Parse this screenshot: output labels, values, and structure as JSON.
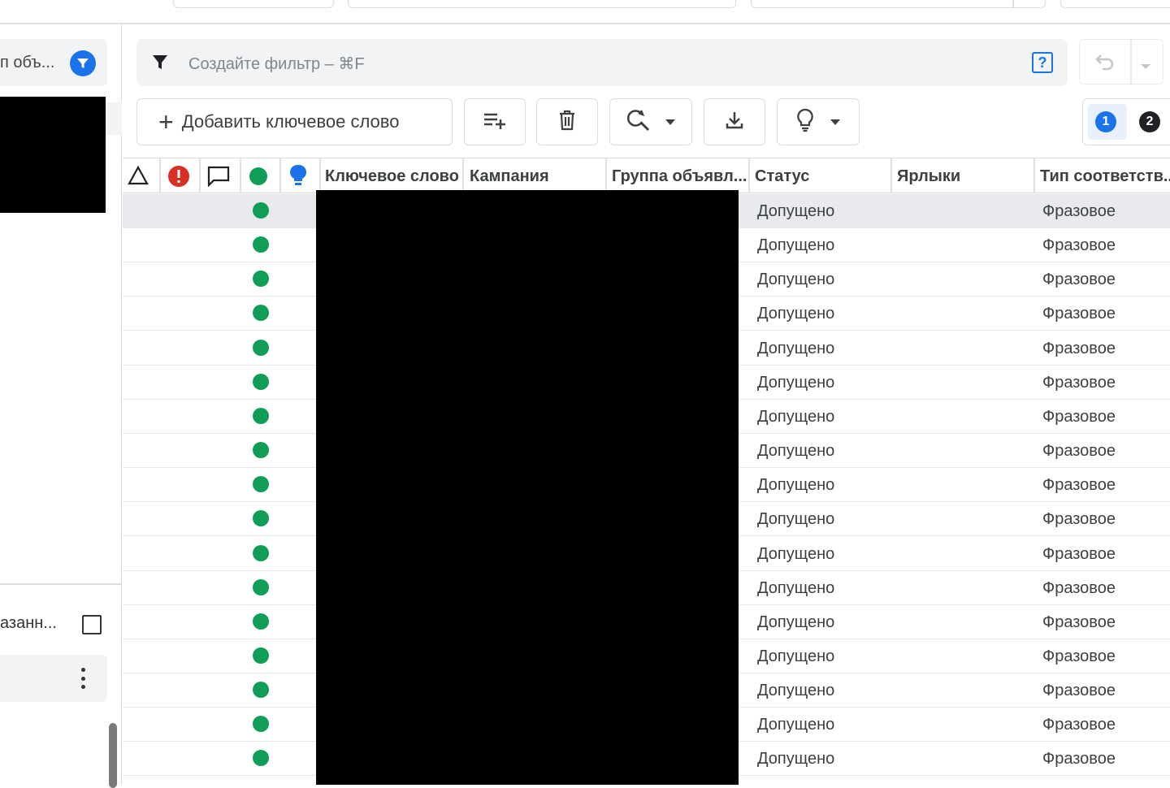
{
  "sidebar": {
    "filter_text": "п объ...",
    "filter_icon": "filter-icon",
    "option_text": "азанн...",
    "menu_icon": "more-vert-icon"
  },
  "filter_bar": {
    "placeholder": "Создайте фильтр – ⌘F",
    "icons": [
      "filter-icon",
      "help-icon"
    ]
  },
  "toolbar": {
    "add_keyword_label": "Добавить ключевое слово",
    "icons": [
      "add-list-icon",
      "delete-icon",
      "find-replace-icon",
      "download-icon",
      "lightbulb-icon"
    ],
    "steps": [
      "1",
      "2"
    ]
  },
  "table": {
    "header_icons": [
      "warning-triangle-icon",
      "error-icon",
      "comment-icon",
      "status-dot-icon",
      "lightbulb-icon"
    ],
    "columns": [
      "Ключевое слово",
      "Кампания",
      "Группа объявл...",
      "Статус",
      "Ярлыки",
      "Тип соответств..."
    ],
    "rows": [
      {
        "status": "Допущено",
        "labels": "",
        "match_type": "Фразовое",
        "selected": true
      },
      {
        "status": "Допущено",
        "labels": "",
        "match_type": "Фразовое"
      },
      {
        "status": "Допущено",
        "labels": "",
        "match_type": "Фразовое"
      },
      {
        "status": "Допущено",
        "labels": "",
        "match_type": "Фразовое"
      },
      {
        "status": "Допущено",
        "labels": "",
        "match_type": "Фразовое"
      },
      {
        "status": "Допущено",
        "labels": "",
        "match_type": "Фразовое"
      },
      {
        "status": "Допущено",
        "labels": "",
        "match_type": "Фразовое"
      },
      {
        "status": "Допущено",
        "labels": "",
        "match_type": "Фразовое"
      },
      {
        "status": "Допущено",
        "labels": "",
        "match_type": "Фразовое"
      },
      {
        "status": "Допущено",
        "labels": "",
        "match_type": "Фразовое"
      },
      {
        "status": "Допущено",
        "labels": "",
        "match_type": "Фразовое"
      },
      {
        "status": "Допущено",
        "labels": "",
        "match_type": "Фразовое"
      },
      {
        "status": "Допущено",
        "labels": "",
        "match_type": "Фразовое"
      },
      {
        "status": "Допущено",
        "labels": "",
        "match_type": "Фразовое"
      },
      {
        "status": "Допущено",
        "labels": "",
        "match_type": "Фразовое"
      },
      {
        "status": "Допущено",
        "labels": "",
        "match_type": "Фразовое"
      },
      {
        "status": "Допущено",
        "labels": "",
        "match_type": "Фразовое"
      }
    ]
  },
  "colors": {
    "accent": "#1a73e8",
    "status_ok": "#0f9d58",
    "error": "#d93025"
  }
}
